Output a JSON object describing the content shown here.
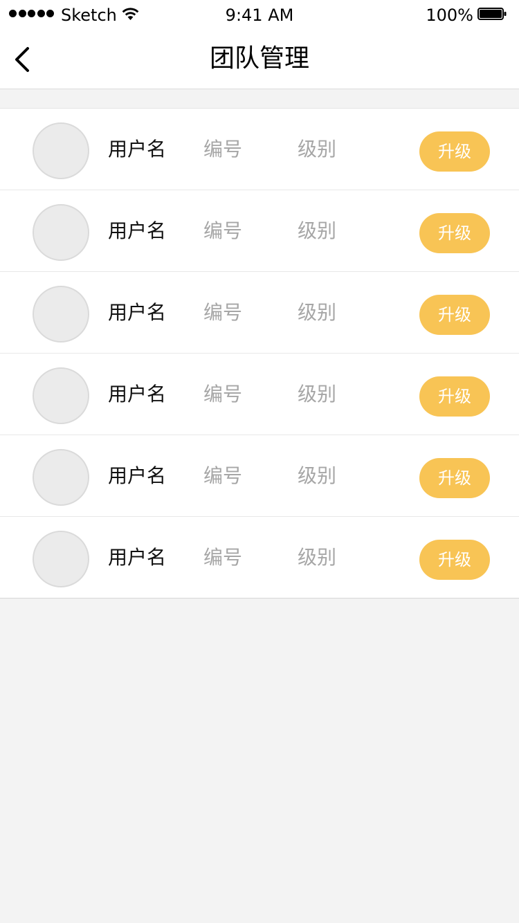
{
  "status_bar": {
    "carrier": "Sketch",
    "time": "9:41 AM",
    "battery_percent": "100%",
    "icons": [
      "signal-dots",
      "wifi-icon",
      "battery-icon"
    ]
  },
  "nav": {
    "title": "团队管理",
    "back_icon": "chevron-left-icon"
  },
  "members": [
    {
      "username": "用户名",
      "number": "编号",
      "level": "级别",
      "action": "升级"
    },
    {
      "username": "用户名",
      "number": "编号",
      "level": "级别",
      "action": "升级"
    },
    {
      "username": "用户名",
      "number": "编号",
      "level": "级别",
      "action": "升级"
    },
    {
      "username": "用户名",
      "number": "编号",
      "level": "级别",
      "action": "升级"
    },
    {
      "username": "用户名",
      "number": "编号",
      "level": "级别",
      "action": "升级"
    },
    {
      "username": "用户名",
      "number": "编号",
      "level": "级别",
      "action": "升级"
    }
  ],
  "colors": {
    "accent": "#f8c455",
    "background": "#f3f3f3",
    "secondary_text": "#a6a6a6"
  }
}
